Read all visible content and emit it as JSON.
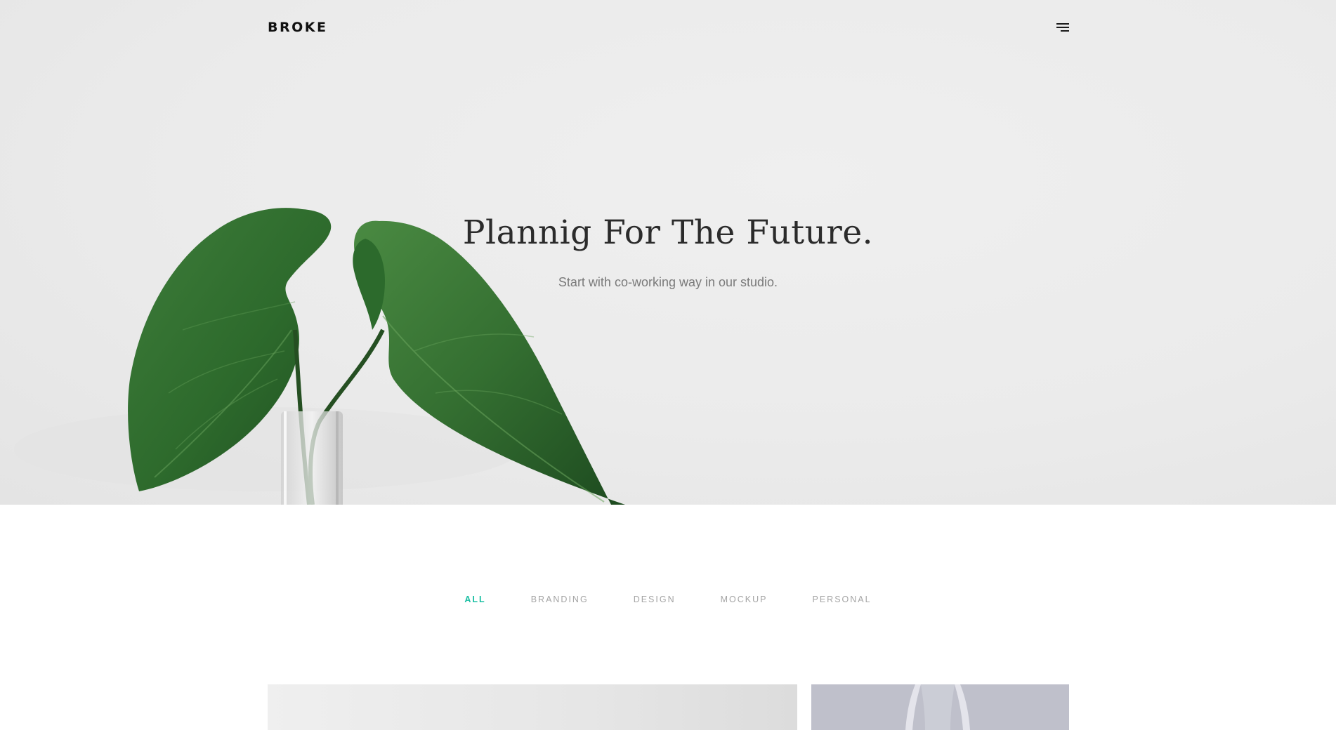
{
  "brand": {
    "logo": "BROKE"
  },
  "header": {
    "menu_icon": "hamburger-menu-icon"
  },
  "hero": {
    "title": "Plannig For The Future.",
    "subtitle": "Start with co-working way in our studio.",
    "image": "green-leaves-in-glass-vase"
  },
  "portfolio": {
    "filters": [
      {
        "label": "ALL",
        "active": true
      },
      {
        "label": "BRANDING",
        "active": false
      },
      {
        "label": "DESIGN",
        "active": false
      },
      {
        "label": "MOCKUP",
        "active": false
      },
      {
        "label": "PERSONAL",
        "active": false
      }
    ],
    "items": [
      {
        "image": "light-gray-studio-photo"
      },
      {
        "image": "glass-vase-on-lavender-background"
      }
    ]
  },
  "colors": {
    "accent": "#1bbfa3",
    "hero_background": "#ececec",
    "title": "#2b2b2b",
    "subtitle": "#7a7a7a",
    "filter_inactive": "#a4a4a4",
    "leaf": "#2f6a30"
  }
}
